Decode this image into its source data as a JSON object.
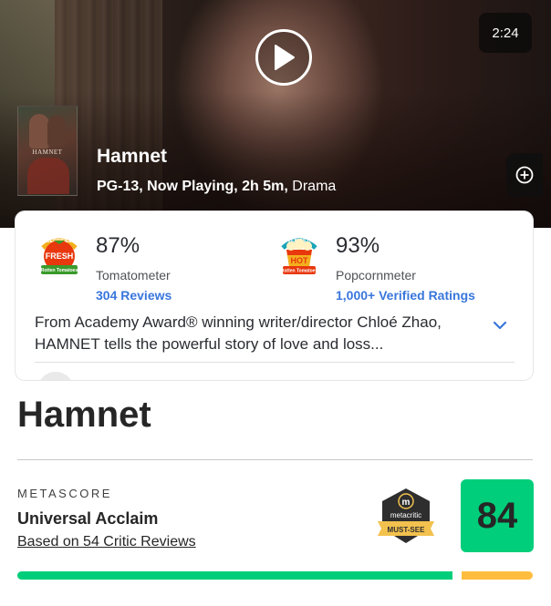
{
  "trailer": {
    "duration": "2:24",
    "play_icon": "play-icon"
  },
  "movie": {
    "poster_text": "HAMNET",
    "title": "Hamnet",
    "meta_main": "PG-13, Now Playing, 2h 5m,",
    "genre": "Drama",
    "add_icon": "plus-circle-icon"
  },
  "ratings": {
    "tomatometer": {
      "badge_icon": "certified-fresh-icon",
      "score": "87%",
      "label": "Tomatometer",
      "reviews_link": "304 Reviews"
    },
    "popcornmeter": {
      "badge_icon": "verified-hot-icon",
      "score": "93%",
      "label": "Popcornmeter",
      "reviews_link": "1,000+ Verified Ratings"
    },
    "synopsis": "From Academy Award® winning writer/director Chloé Zhao, HAMNET tells the powerful story of love and loss...",
    "expand_icon": "chevron-down-icon"
  },
  "metacritic": {
    "title": "Hamnet",
    "label": "METASCORE",
    "verdict": "Universal Acclaim",
    "reviews_link": "Based on 54 Critic Reviews",
    "badge_icon": "metacritic-must-see-icon",
    "score": "84",
    "distribution": {
      "positive_fraction": 0.84,
      "mixed_fraction": 0.14,
      "negative_fraction": 0.0
    },
    "colors": {
      "positive": "#00ce7a",
      "mixed": "#ffbd3f"
    }
  }
}
